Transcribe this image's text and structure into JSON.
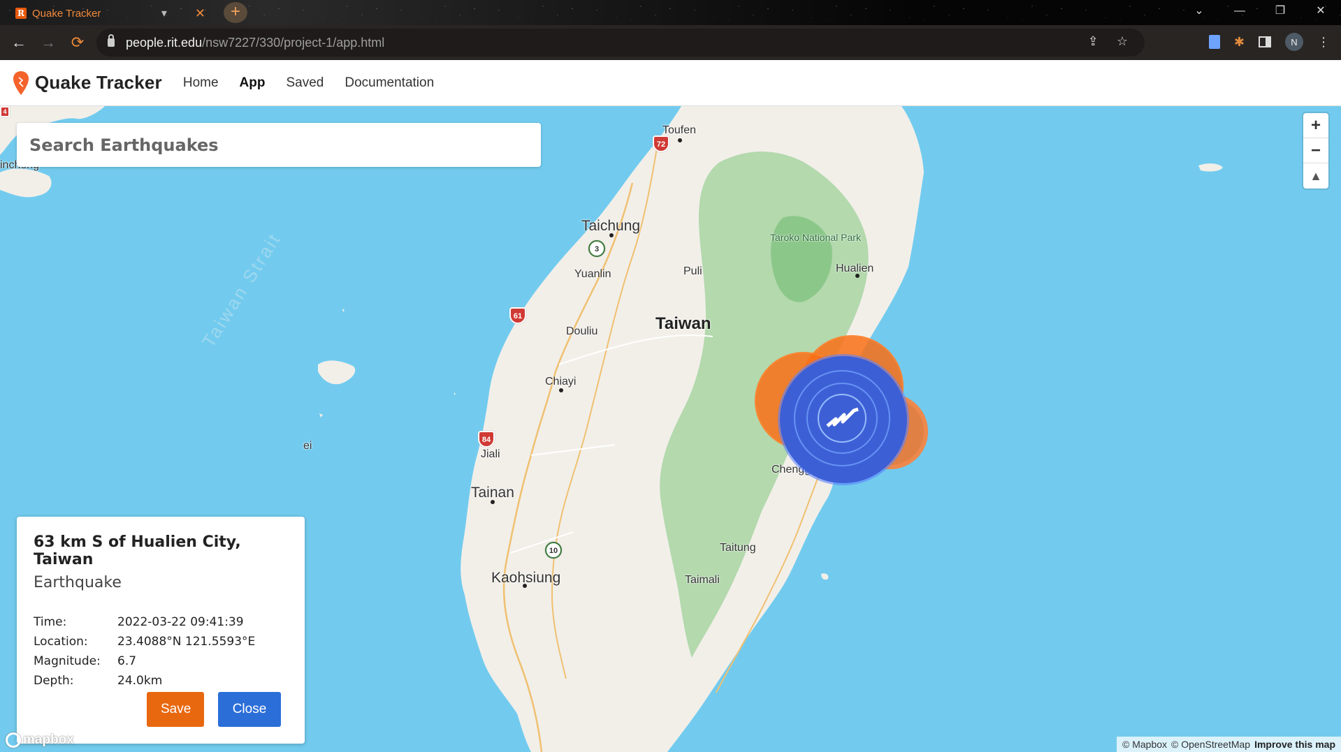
{
  "browser": {
    "tab_title": "Quake Tracker",
    "tab_favicon": "R",
    "new_tab_label": "+",
    "url_host": "people.rit.edu",
    "url_path": "/nsw7227/330/project-1/app.html",
    "avatar_initial": "N"
  },
  "nav": {
    "brand": "Quake Tracker",
    "links": [
      "Home",
      "App",
      "Saved",
      "Documentation"
    ],
    "active": "App"
  },
  "search": {
    "placeholder": "Search Earthquakes"
  },
  "map": {
    "labels": {
      "toufen": "Toufen",
      "taichung": "Taichung",
      "taroko": "Taroko National Park",
      "hualien": "Hualien",
      "yuanlin": "Yuanlin",
      "puli": "Puli",
      "taiwan": "Taiwan",
      "strait": "Taiwan Strait",
      "douliu": "Douliu",
      "chiayi": "Chiayi",
      "chenggong": "Chenggong",
      "jiali": "Jiali",
      "tainan": "Tainan",
      "taitung": "Taitung",
      "kaohsiung": "Kaohsiung",
      "taimali": "Taimali",
      "incheng": "incheng",
      "pei": "ei"
    },
    "shields": {
      "r72": "72",
      "r61": "61",
      "r84": "84",
      "r3": "3",
      "r10": "10",
      "r4": "4"
    },
    "zoom_in": "+",
    "zoom_out": "−",
    "compass": "▲",
    "logo": "mapbox",
    "attribution_1": "© Mapbox",
    "attribution_2": "© OpenStreetMap",
    "attribution_3": "Improve this map"
  },
  "popup": {
    "title": "63 km S of Hualien City, Taiwan",
    "subtitle": "Earthquake",
    "rows": [
      {
        "key": "Time:",
        "value": "2022-03-22 09:41:39"
      },
      {
        "key": "Location:",
        "value": "23.4088°N 121.5593°E"
      },
      {
        "key": "Magnitude:",
        "value": "6.7"
      },
      {
        "key": "Depth:",
        "value": "24.0km"
      }
    ],
    "save_label": "Save",
    "close_label": "Close"
  },
  "colors": {
    "accent_orange": "#e8680f",
    "accent_blue": "#2b6ed8",
    "quake_orange": "#f96f15",
    "quake_blue": "#3d5fd6",
    "water": "#72cbee"
  }
}
